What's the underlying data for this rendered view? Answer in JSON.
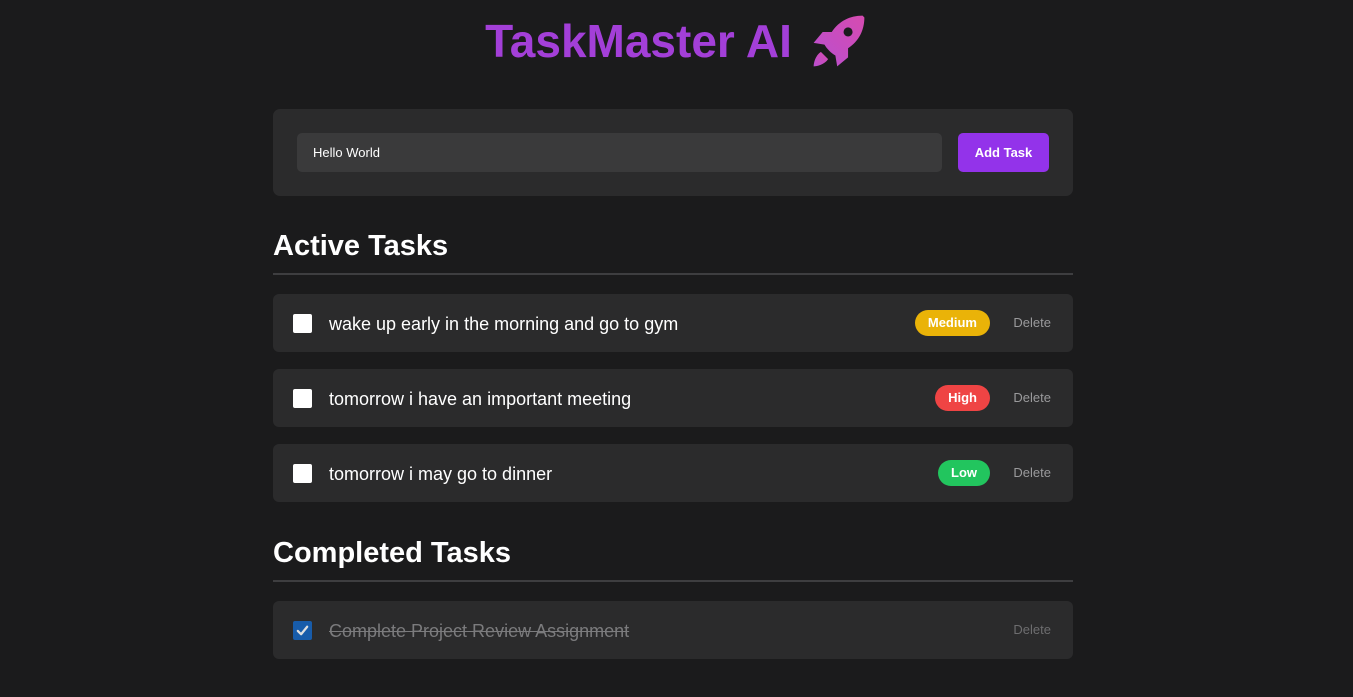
{
  "app": {
    "title": "TaskMaster AI",
    "title_color": "#a33fd8",
    "icon": "rocket-icon"
  },
  "add_task": {
    "input_value": "Hello World",
    "button_label": "Add Task",
    "button_color": "#9333ea"
  },
  "active_section": {
    "title": "Active Tasks",
    "tasks": [
      {
        "text": "wake up early in the morning and go to gym",
        "priority": "Medium",
        "priority_color": "#eab308",
        "delete_label": "Delete",
        "checked": false
      },
      {
        "text": "tomorrow i have an important meeting",
        "priority": "High",
        "priority_color": "#ef4444",
        "delete_label": "Delete",
        "checked": false
      },
      {
        "text": "tomorrow i may go to dinner",
        "priority": "Low",
        "priority_color": "#22c55e",
        "delete_label": "Delete",
        "checked": false
      }
    ]
  },
  "completed_section": {
    "title": "Completed Tasks",
    "tasks": [
      {
        "text": "Complete Project Review Assignment",
        "delete_label": "Delete",
        "checked": true
      }
    ]
  }
}
